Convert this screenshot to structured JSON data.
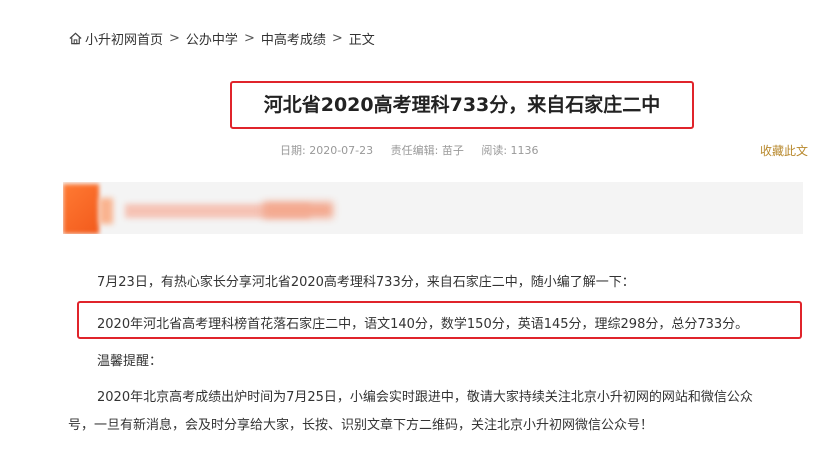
{
  "breadcrumb": {
    "home": "小升初网首页",
    "sep": ">",
    "item1": "公办中学",
    "item2": "中高考成绩",
    "item3": "正文"
  },
  "article": {
    "title": "河北省2020高考理科733分，来自石家庄二中",
    "date": "日期: 2020-07-23",
    "editor": "责任编辑: 苗子",
    "views": "阅读: 1136",
    "favorite": "收藏此文",
    "para1": "7月23日，有热心家长分享河北省2020高考理科733分，来自石家庄二中，随小编了解一下：",
    "para2": "2020年河北省高考理科榜首花落石家庄二中，语文140分，数学150分，英语145分，理综298分，总分733分。",
    "tip_heading": "温馨提醒：",
    "tip_line1": "2020年北京高考成绩出炉时间为7月25日，小编会实时跟进中，敬请大家持续关注北京小升初网的网站和微信公众",
    "tip_line2": "号，一旦有新消息，会及时分享给大家，长按、识别文章下方二维码，关注北京小升初网微信公众号！"
  },
  "colors": {
    "highlight_border": "#e0242b",
    "favorite_link": "#b8892d"
  }
}
